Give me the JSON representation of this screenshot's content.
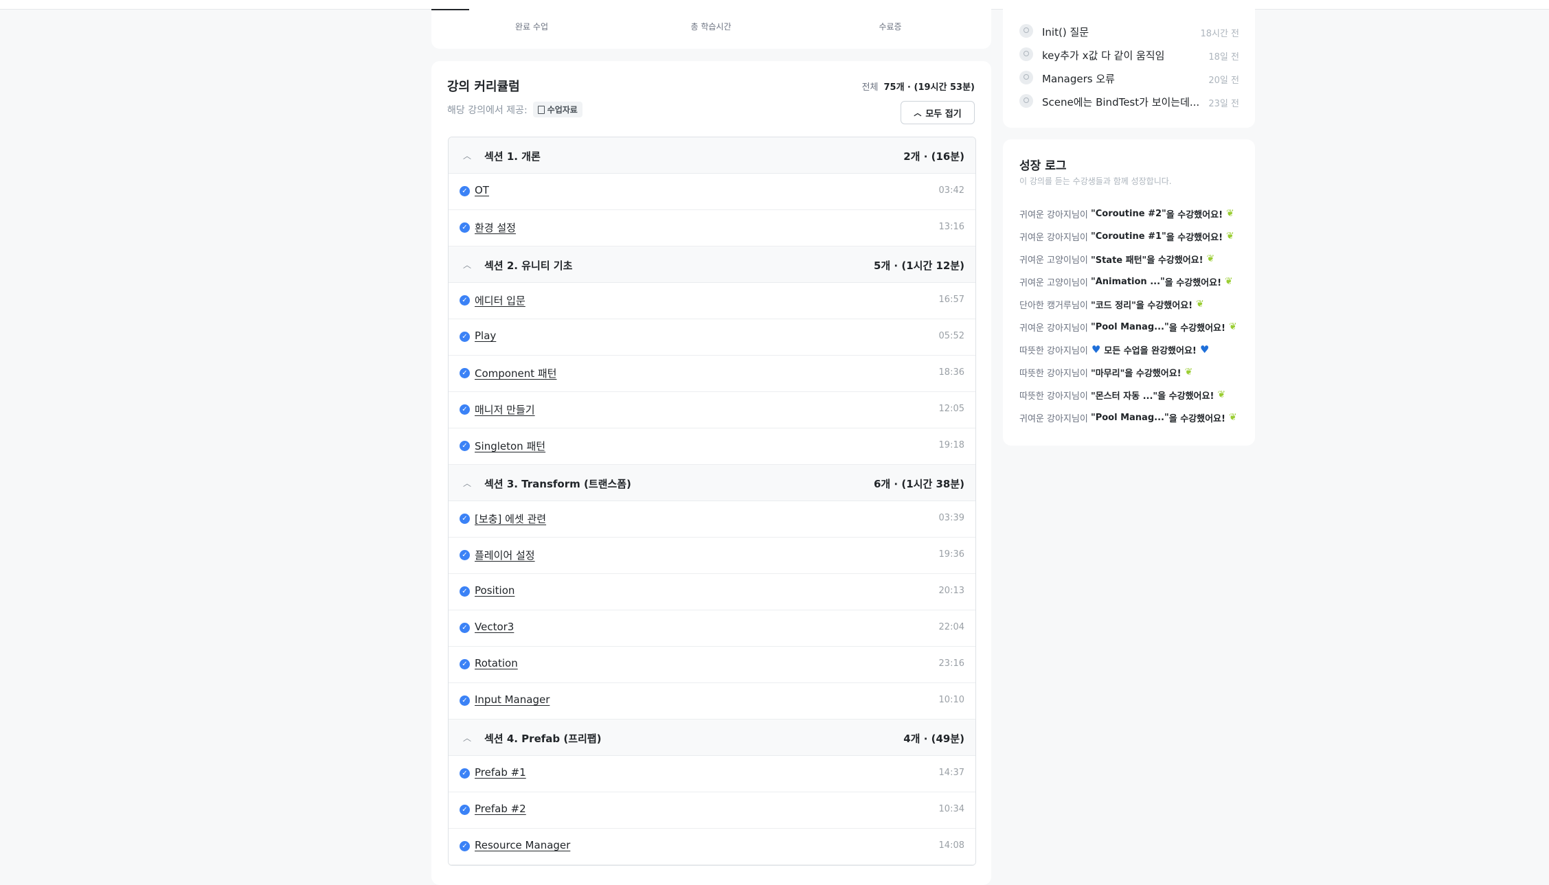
{
  "stats": {
    "labels": [
      "완료 수업",
      "총 학습시간",
      "수료증"
    ]
  },
  "curriculum": {
    "title": "강의 커리큘럼",
    "total_label": "전체",
    "total_value": "75개 ∙ (19시간 53분)",
    "provided_label": "해당 강의에서 제공:",
    "material_badge": "수업자료",
    "collapse_button": "모두 접기",
    "sections": [
      {
        "title": "섹션 1. 개론",
        "meta": "2개 ∙ (16분)",
        "lessons": [
          {
            "title": "OT",
            "time": "03:42"
          },
          {
            "title": "환경 설정",
            "time": "13:16"
          }
        ]
      },
      {
        "title": "섹션 2. 유니티 기초",
        "meta": "5개 ∙ (1시간 12분)",
        "lessons": [
          {
            "title": "에디터 입문",
            "time": "16:57"
          },
          {
            "title": "Play",
            "time": "05:52"
          },
          {
            "title": "Component 패턴",
            "time": "18:36"
          },
          {
            "title": "매니저 만들기",
            "time": "12:05"
          },
          {
            "title": "Singleton 패턴",
            "time": "19:18"
          }
        ]
      },
      {
        "title": "섹션 3. Transform (트랜스폼)",
        "meta": "6개 ∙ (1시간 38분)",
        "lessons": [
          {
            "title": "[보충] 에셋 관련",
            "time": "03:39"
          },
          {
            "title": "플레이어 설정",
            "time": "19:36"
          },
          {
            "title": "Position",
            "time": "20:13"
          },
          {
            "title": "Vector3",
            "time": "22:04"
          },
          {
            "title": "Rotation",
            "time": "23:16"
          },
          {
            "title": "Input Manager",
            "time": "10:10"
          }
        ]
      },
      {
        "title": "섹션 4. Prefab (프리팹)",
        "meta": "4개 ∙ (49분)",
        "lessons": [
          {
            "title": "Prefab #1",
            "time": "14:37"
          },
          {
            "title": "Prefab #2",
            "time": "10:34"
          },
          {
            "title": "Resource Manager",
            "time": "14:08"
          }
        ]
      }
    ]
  },
  "questions": [
    {
      "title": "Init() 질문",
      "time": "18시간 전"
    },
    {
      "title": "key추가 x값 다 같이 움직임",
      "time": "18일 전"
    },
    {
      "title": "Managers 오류",
      "time": "20일 전"
    },
    {
      "title": "Scene에는 BindTest가 보이는데...",
      "time": "23일 전"
    }
  ],
  "growth_log": {
    "title": "성장 로그",
    "subtitle": "이 강의를 듣는 수강생들과 함께 성장합니다.",
    "items": [
      {
        "user": "귀여운 강아지님이",
        "lesson": "\"Coroutine #2\"",
        "suffix": "을 수강했어요!",
        "icon": "sprout"
      },
      {
        "user": "귀여운 강아지님이",
        "lesson": "\"Coroutine #1\"",
        "suffix": "을 수강했어요!",
        "icon": "sprout"
      },
      {
        "user": "귀여운 고양이님이",
        "lesson": "\"State 패턴\"",
        "suffix": "을 수강했어요!",
        "icon": "sprout"
      },
      {
        "user": "귀여운 고양이님이",
        "lesson": "\"Animation ...\"",
        "suffix": "을 수강했어요!",
        "icon": "sprout"
      },
      {
        "user": "단아한 캥거루님이",
        "lesson": "\"코드 정리\"",
        "suffix": "을 수강했어요!",
        "icon": "sprout"
      },
      {
        "user": "귀여운 강아지님이",
        "lesson": "\"Pool Manag...\"",
        "suffix": "을 수강했어요!",
        "icon": "sprout"
      },
      {
        "user": "따뜻한 강아지님이",
        "lesson": "",
        "suffix": "모든 수업을 완강했어요!",
        "icon": "heart"
      },
      {
        "user": "따뜻한 강아지님이",
        "lesson": "\"마무리\"",
        "suffix": "을 수강했어요!",
        "icon": "sprout"
      },
      {
        "user": "따뜻한 강아지님이",
        "lesson": "\"몬스터 자동 ...\"",
        "suffix": "을 수강했어요!",
        "icon": "sprout"
      },
      {
        "user": "귀여운 강아지님이",
        "lesson": "\"Pool Manag...\"",
        "suffix": "을 수강했어요!",
        "icon": "sprout"
      }
    ]
  },
  "colors": {
    "accent_blue": "#3b82f6",
    "heart_blue": "#1e6fd9",
    "sprout_green": "#9acd32"
  }
}
